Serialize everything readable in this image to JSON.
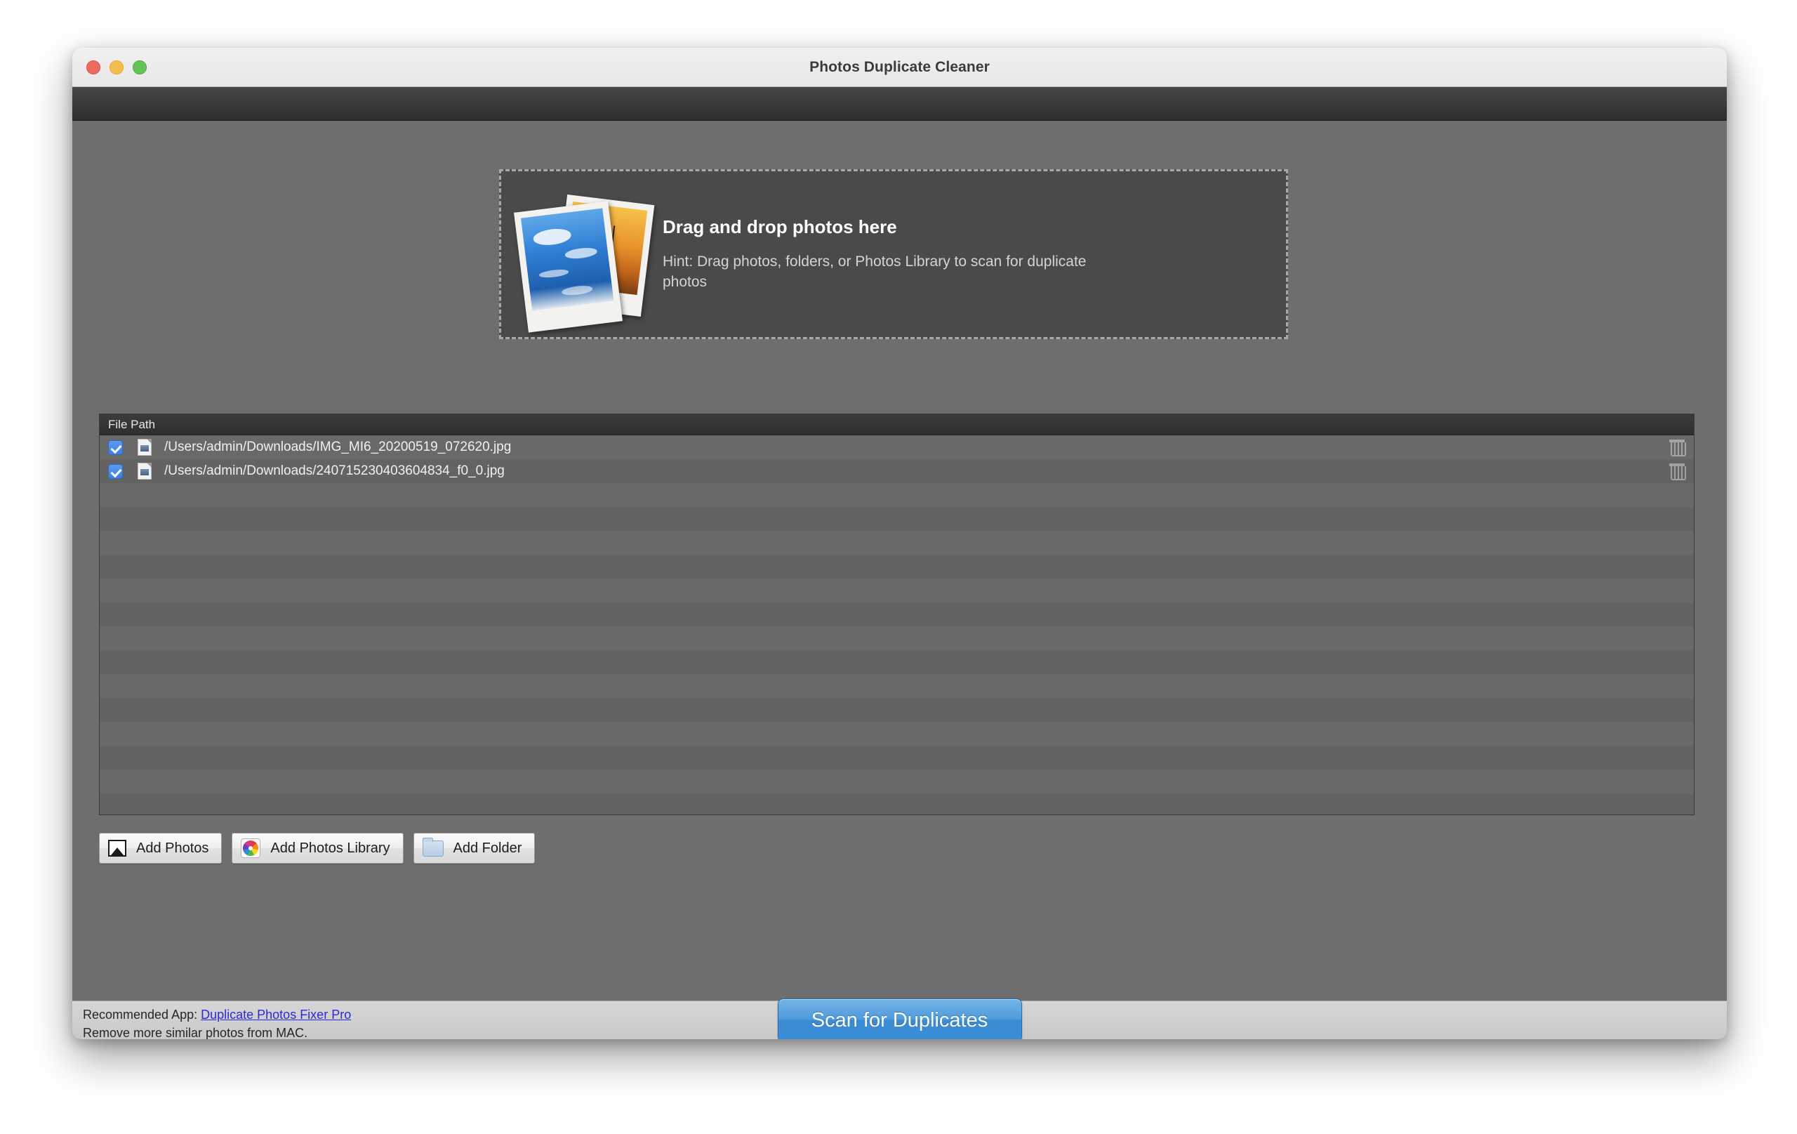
{
  "window": {
    "title": "Photos Duplicate Cleaner",
    "traffic_lights": [
      "close",
      "minimize",
      "maximize"
    ]
  },
  "dropzone": {
    "title": "Drag and drop photos here",
    "hint": "Hint: Drag photos, folders, or Photos Library to scan for duplicate photos",
    "icon": "photo-stack-icon"
  },
  "filelist": {
    "column_header": "File Path",
    "rows": [
      {
        "checked": true,
        "path": "/Users/admin/Downloads/IMG_MI6_20200519_072620.jpg"
      },
      {
        "checked": true,
        "path": "/Users/admin/Downloads/240715230403604834_f0_0.jpg"
      }
    ]
  },
  "actions": {
    "add_photos": "Add Photos",
    "add_photos_library": "Add Photos Library",
    "add_folder": "Add Folder"
  },
  "footer": {
    "recommended_prefix": "Recommended App: ",
    "recommended_link": "Duplicate Photos Fixer Pro",
    "recommended_sub": "Remove more similar photos from MAC.",
    "scan_button": "Scan for Duplicates"
  },
  "colors": {
    "accent_blue": "#3a8ed8",
    "checkbox_blue": "#3d7fe0",
    "link_blue": "#2a2ad6",
    "window_bg": "#6e6e6e",
    "dropzone_bg": "#4a4a4a"
  }
}
